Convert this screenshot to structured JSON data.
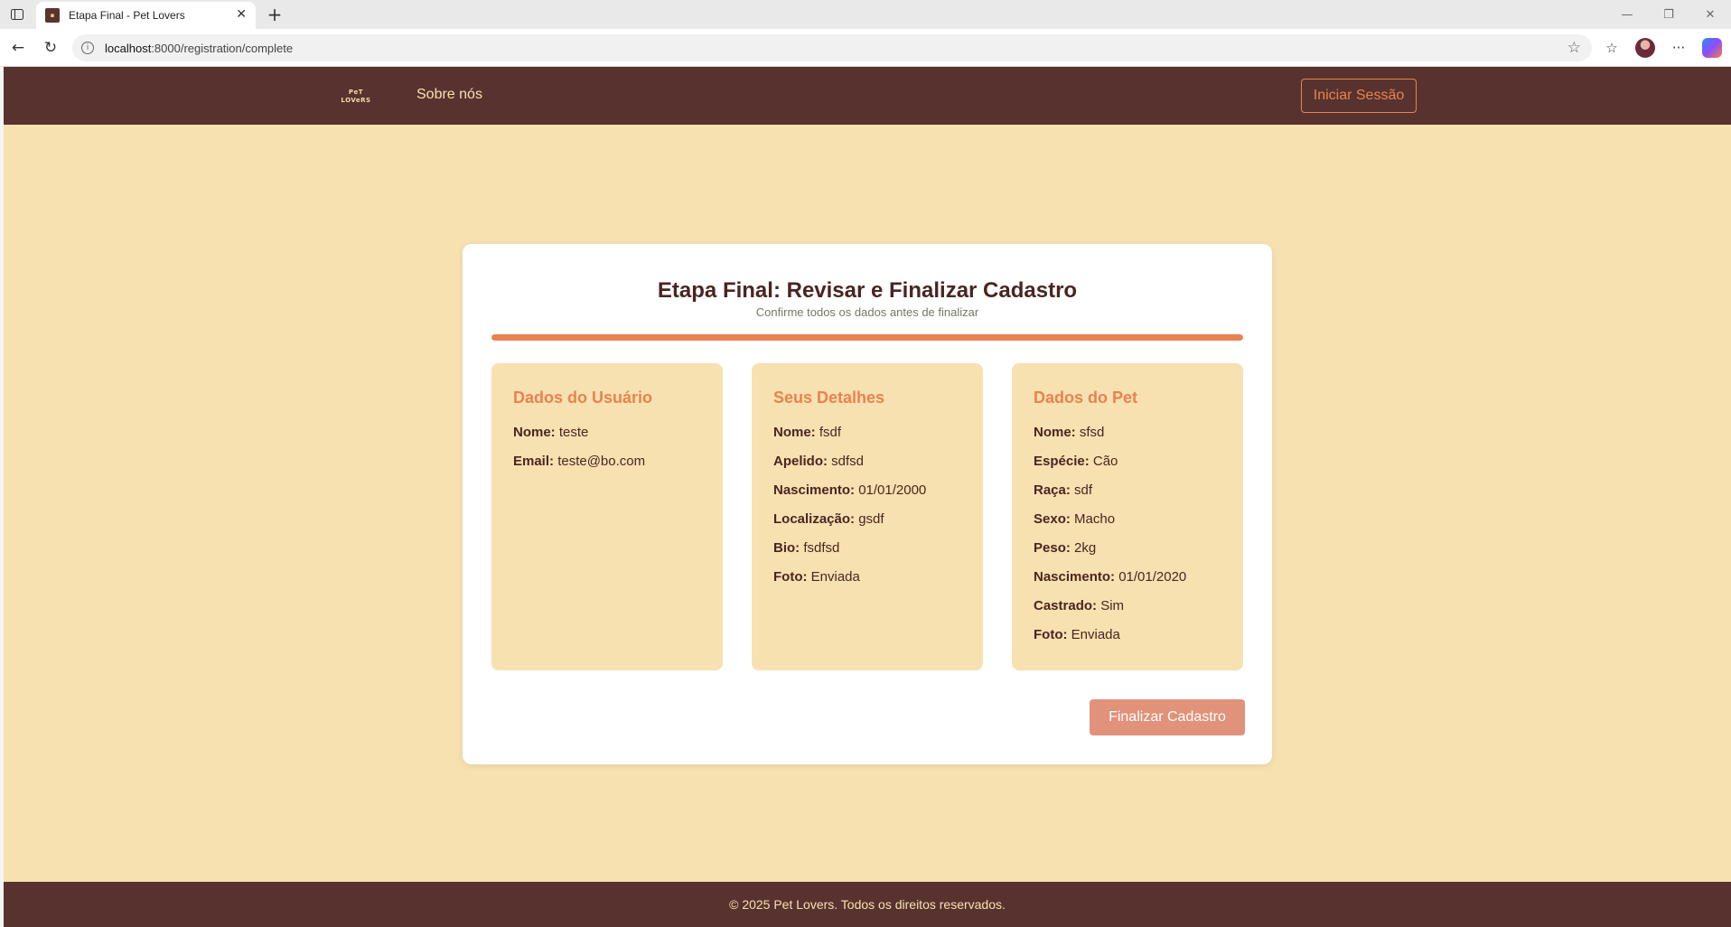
{
  "browser": {
    "tab_title": "Etapa Final - Pet Lovers",
    "url_host": "localhost",
    "url_rest": ":8000/registration/complete"
  },
  "header": {
    "logo_line1": "PeT",
    "logo_line2": "LOVeRS",
    "nav_about": "Sobre nós",
    "login_label": "Iniciar Sessão"
  },
  "card": {
    "title": "Etapa Final: Revisar e Finalizar Cadastro",
    "subtitle": "Confirme todos os dados antes de finalizar",
    "progress": 1.0,
    "finish_label": "Finalizar Cadastro"
  },
  "sections": [
    {
      "title": "Dados do Usuário",
      "rows": [
        {
          "label": "Nome:",
          "value": "teste"
        },
        {
          "label": "Email:",
          "value": "teste@bo.com"
        }
      ]
    },
    {
      "title": "Seus Detalhes",
      "rows": [
        {
          "label": "Nome:",
          "value": "fsdf"
        },
        {
          "label": "Apelido:",
          "value": "sdfsd"
        },
        {
          "label": "Nascimento:",
          "value": "01/01/2000"
        },
        {
          "label": "Localização:",
          "value": "gsdf"
        },
        {
          "label": "Bio:",
          "value": "fsdfsd"
        },
        {
          "label": "Foto:",
          "value": "Enviada"
        }
      ]
    },
    {
      "title": "Dados do Pet",
      "rows": [
        {
          "label": "Nome:",
          "value": "sfsd"
        },
        {
          "label": "Espécie:",
          "value": "Cão"
        },
        {
          "label": "Raça:",
          "value": "sdf"
        },
        {
          "label": "Sexo:",
          "value": "Macho"
        },
        {
          "label": "Peso:",
          "value": "2kg"
        },
        {
          "label": "Nascimento:",
          "value": "01/01/2020"
        },
        {
          "label": "Castrado:",
          "value": "Sim"
        },
        {
          "label": "Foto:",
          "value": "Enviada"
        }
      ]
    }
  ],
  "footer": {
    "text": "© 2025 Pet Lovers. Todos os direitos reservados."
  },
  "colors": {
    "header_bg": "#58322e",
    "page_bg": "#f7e1b0",
    "accent": "#e8834f",
    "button": "#e0927a"
  }
}
